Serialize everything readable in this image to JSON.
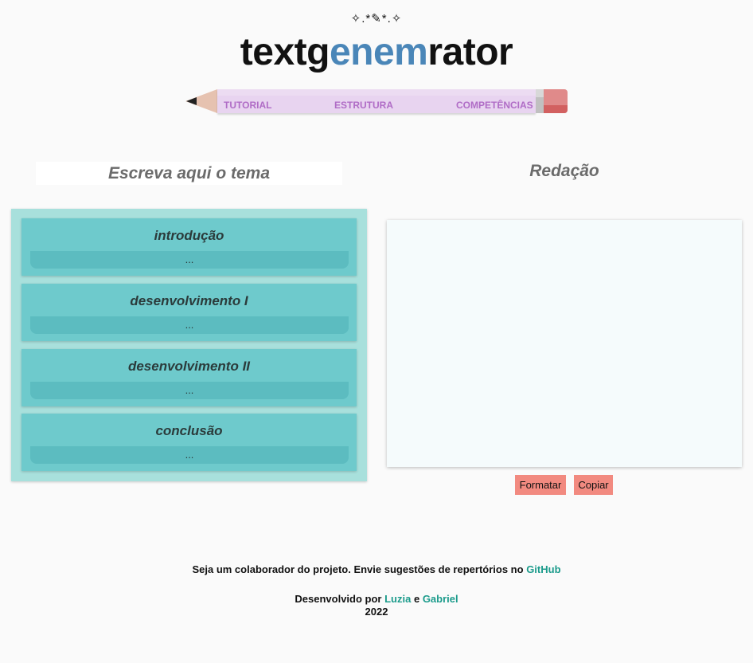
{
  "header": {
    "sparkle": "✧.*✎*.✧",
    "logo": {
      "part1": "textg",
      "highlight": "enem",
      "part2": "rator"
    },
    "highlight_color": "#4a86b8"
  },
  "nav": {
    "items": [
      {
        "label": "TUTORIAL"
      },
      {
        "label": "ESTRUTURA"
      },
      {
        "label": "COMPETÊNCIAS"
      }
    ],
    "color": "#b06cc6"
  },
  "theme": {
    "label": "Escreva aqui o tema"
  },
  "outline": {
    "sections": [
      {
        "title": "introdução",
        "value": "..."
      },
      {
        "title": "desenvolvimento I",
        "value": "..."
      },
      {
        "title": "desenvolvimento II",
        "value": "..."
      },
      {
        "title": "conclusão",
        "value": "..."
      }
    ]
  },
  "essay": {
    "title": "Redação",
    "text": ""
  },
  "actions": {
    "format": "Formatar",
    "copy": "Copiar",
    "color": "#f28a80"
  },
  "footer": {
    "collab_text": "Seja um colaborador do projeto. Envie sugestões de repertórios no",
    "github": "GitHub",
    "dev_text": "Desenvolvido por",
    "author1": "Luzia",
    "and": "e",
    "author2": "Gabriel",
    "year": "2022",
    "link_color": "#1b9b8b"
  }
}
